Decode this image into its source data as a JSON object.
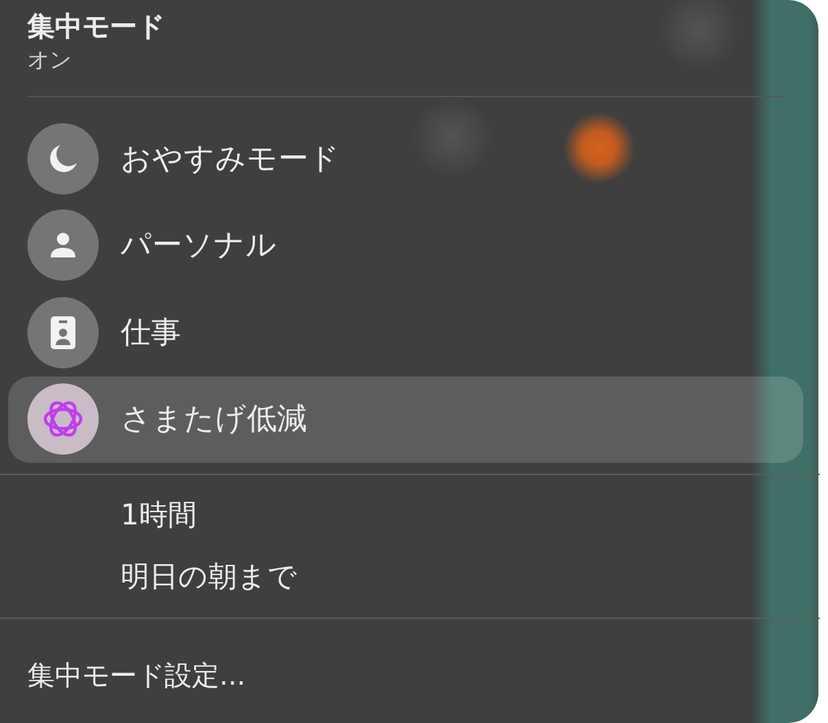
{
  "header": {
    "title": "集中モード",
    "status": "オン"
  },
  "modes": [
    {
      "kind": "moon",
      "label": "おやすみモード",
      "selected": false
    },
    {
      "kind": "person",
      "label": "パーソナル",
      "selected": false
    },
    {
      "kind": "badge",
      "label": "仕事",
      "selected": false
    },
    {
      "kind": "flower",
      "label": "さまたげ低減",
      "selected": true
    }
  ],
  "durations": [
    "1時間",
    "明日の朝まで"
  ],
  "settings_link": "集中モード設定..."
}
